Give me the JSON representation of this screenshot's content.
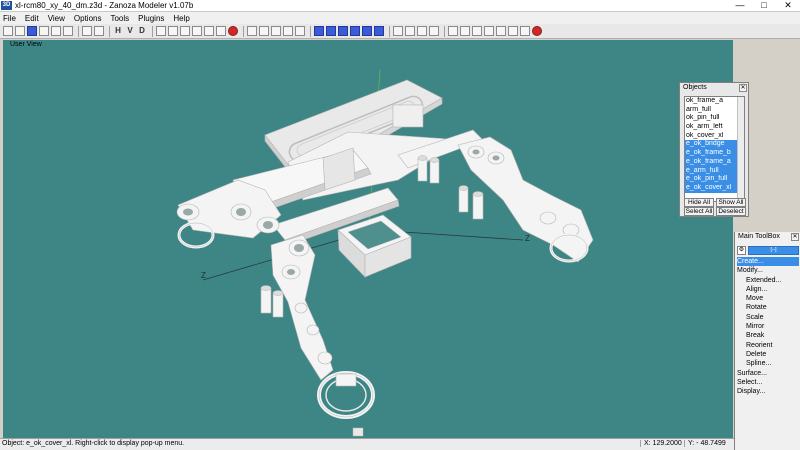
{
  "window": {
    "title": "xl-rcm80_xy_40_dm.z3d - Zanoza Modeler v1.07b",
    "app_icon": "3D",
    "controls": [
      "—",
      "□",
      "✕"
    ]
  },
  "menu": [
    "File",
    "Edit",
    "View",
    "Options",
    "Tools",
    "Plugins",
    "Help"
  ],
  "toolbar": {
    "letters": [
      "H",
      "V",
      "D"
    ]
  },
  "viewport": {
    "label": "User View",
    "background": "#3e8685",
    "model_color": "#f2f2f2",
    "selected_color": "#f2f2f2",
    "axis_labels": [
      "Z",
      "Z"
    ]
  },
  "objects_panel": {
    "title": "Objects",
    "close": "✕",
    "items": [
      {
        "label": "ok_frame_a",
        "selected": false
      },
      {
        "label": "arm_full",
        "selected": false
      },
      {
        "label": "ok_pin_full",
        "selected": false
      },
      {
        "label": "ok_arm_left",
        "selected": false
      },
      {
        "label": "ok_cover_xl",
        "selected": false
      },
      {
        "label": "e_ok_bridge",
        "selected": true
      },
      {
        "label": "e_ok_frame_b",
        "selected": true
      },
      {
        "label": "e_ok_frame_a",
        "selected": true
      },
      {
        "label": "e_arm_full",
        "selected": true
      },
      {
        "label": "e_ok_pin_full",
        "selected": true
      },
      {
        "label": "e_ok_cover_xl",
        "selected": true
      }
    ],
    "buttons": {
      "hide_all": "Hide All",
      "show_all": "Show All",
      "select_all": "Select All",
      "deselect": "Deselect"
    }
  },
  "toolbox": {
    "title": "Main ToolBox",
    "close": "✕",
    "field": "[--]",
    "items": [
      {
        "label": "Create...",
        "selected": true,
        "sub": false
      },
      {
        "label": "Modify...",
        "selected": false,
        "sub": false
      },
      {
        "label": "Extended...",
        "selected": false,
        "sub": true
      },
      {
        "label": "Align...",
        "selected": false,
        "sub": true
      },
      {
        "label": "Move",
        "selected": false,
        "sub": true
      },
      {
        "label": "Rotate",
        "selected": false,
        "sub": true
      },
      {
        "label": "Scale",
        "selected": false,
        "sub": true
      },
      {
        "label": "Mirror",
        "selected": false,
        "sub": true
      },
      {
        "label": "Break",
        "selected": false,
        "sub": true
      },
      {
        "label": "Reorient",
        "selected": false,
        "sub": true
      },
      {
        "label": "Delete",
        "selected": false,
        "sub": true
      },
      {
        "label": "Spline...",
        "selected": false,
        "sub": true
      },
      {
        "label": "Surface...",
        "selected": false,
        "sub": false
      },
      {
        "label": "Select...",
        "selected": false,
        "sub": false
      },
      {
        "label": "Display...",
        "selected": false,
        "sub": false
      }
    ]
  },
  "status": {
    "message": "Object: e_ok_cover_xl. Right-click to display pop-up menu.",
    "x": "X: 129.2000",
    "y": "Y: - 48.7499"
  }
}
